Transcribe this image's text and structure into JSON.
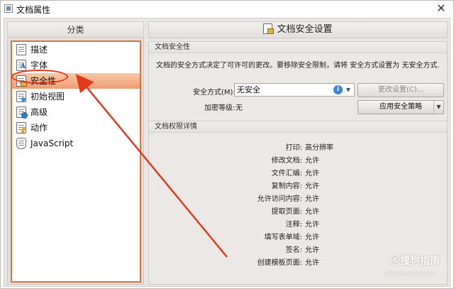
{
  "window": {
    "title": "文档属性",
    "close_label": "✕"
  },
  "left": {
    "header": "分类",
    "items": [
      {
        "label": "描述",
        "icon": "document-icon"
      },
      {
        "label": "字体",
        "icon": "font-icon"
      },
      {
        "label": "安全性",
        "icon": "lock-icon",
        "selected": true
      },
      {
        "label": "初始视图",
        "icon": "view-icon"
      },
      {
        "label": "高级",
        "icon": "gear-icon"
      },
      {
        "label": "动作",
        "icon": "action-icon"
      },
      {
        "label": "JavaScript",
        "icon": "script-icon"
      }
    ]
  },
  "right": {
    "header": "文档安全设置",
    "security_group": {
      "title": "文档安全性",
      "description": "文档的安全方式决定了可许可的更改。要移除安全限制，请将 安全方式设置为 无安全方式.",
      "method_label": "安全方式(M):",
      "method_value": "无安全",
      "info_glyph": "i",
      "change_settings_label": "更改设置(C)...",
      "encryption_label": "加密等级:",
      "encryption_value": "无",
      "apply_policy_label": "应用安全策略"
    },
    "permissions_group": {
      "title": "文档权限详情",
      "rows": [
        {
          "label": "打印:",
          "value": "高分辨率"
        },
        {
          "label": "修改文档:",
          "value": "允许"
        },
        {
          "label": "文件汇编:",
          "value": "允许"
        },
        {
          "label": "复制内容:",
          "value": "允许"
        },
        {
          "label": "允许访问内容:",
          "value": "允许"
        },
        {
          "label": "提取页面:",
          "value": "允许"
        },
        {
          "label": "注释:",
          "value": "允许"
        },
        {
          "label": "填写表单域:",
          "value": "允许"
        },
        {
          "label": "签名:",
          "value": "允许"
        },
        {
          "label": "创建模板页面:",
          "value": "允许"
        }
      ]
    }
  },
  "watermark": {
    "text": "Ⓢ搜狗指南",
    "sub": "zhinan.sogou.com"
  },
  "colors": {
    "annotation_red": "#e23a1a",
    "selection": "#ee9d72",
    "list_border": "#e0703a"
  }
}
